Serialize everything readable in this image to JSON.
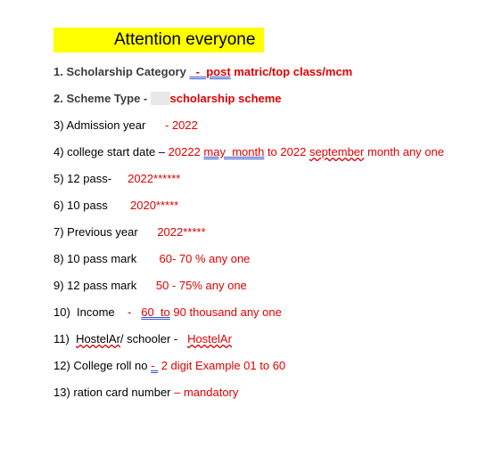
{
  "title": "Attention everyone",
  "items": [
    {
      "parts": [
        "1. Scholarship Category ",
        "  -  ",
        "post",
        " matric/top class/mcm"
      ]
    },
    {
      "parts": [
        "2. Scheme Type - ",
        "      ",
        "scholarship scheme"
      ]
    },
    {
      "parts": [
        "3) Admission year      ",
        "- 2022"
      ]
    },
    {
      "parts": [
        "4) college start date – ",
        "20222 ",
        "may  month",
        " to 2022 ",
        "september",
        " month any one"
      ]
    },
    {
      "parts": [
        "5) 12 pass-     ",
        "2022******"
      ]
    },
    {
      "parts": [
        "6) 10 pass       ",
        "2020*****"
      ]
    },
    {
      "parts": [
        "7) Previous year      ",
        "2022*****"
      ]
    },
    {
      "parts": [
        "8) 10 pass mark       ",
        "60- 70 % any one"
      ]
    },
    {
      "parts": [
        "9) 12 pass mark      ",
        "50 - 75% any one"
      ]
    },
    {
      "parts": [
        "10)  Income    ",
        "-   ",
        "60  to",
        " 90 thousand any one"
      ]
    },
    {
      "parts": [
        "11)  ",
        "HostelAr",
        "/ schooler -   ",
        "HostelAr"
      ]
    },
    {
      "parts": [
        "12) College roll no ",
        "- ",
        " 2 digit Example 01 to 60"
      ]
    },
    {
      "parts": [
        "13) ration card number ",
        "– mandatory"
      ]
    }
  ]
}
